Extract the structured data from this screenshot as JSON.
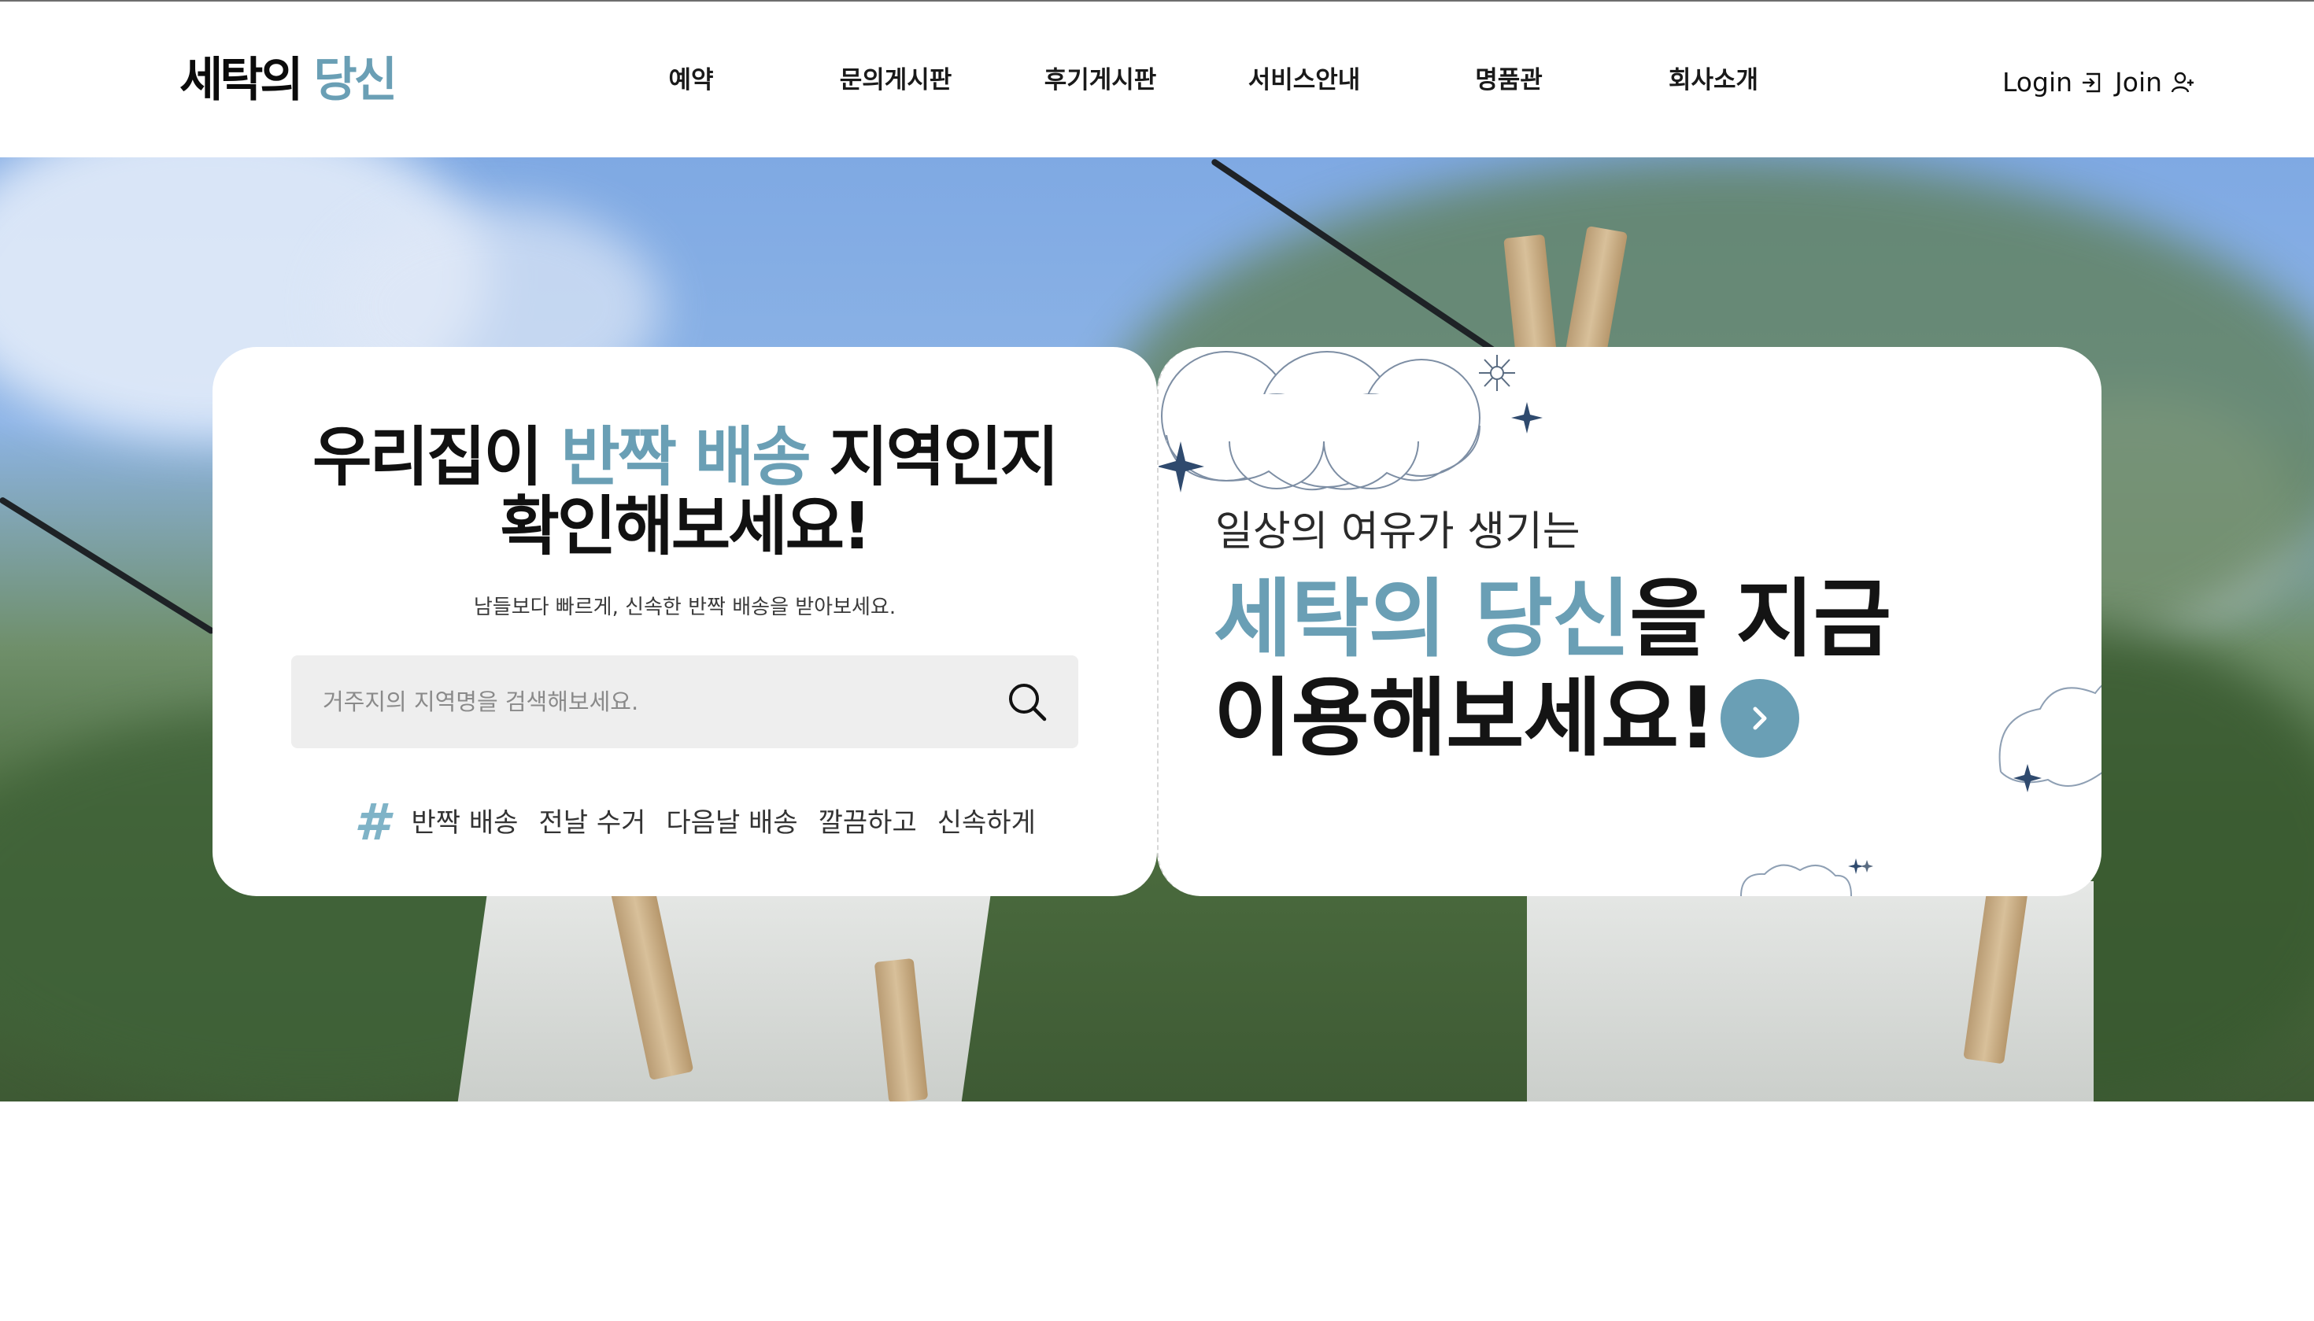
{
  "header": {
    "logo": {
      "part1": "세탁의 ",
      "part2": "당신"
    },
    "nav": [
      {
        "label": "예약"
      },
      {
        "label": "문의게시판"
      },
      {
        "label": "후기게시판"
      },
      {
        "label": "서비스안내"
      },
      {
        "label": "명품관"
      },
      {
        "label": "회사소개"
      }
    ],
    "auth": {
      "login": "Login",
      "join": "Join"
    }
  },
  "search_card": {
    "headline_line1_pre": "우리집이 ",
    "headline_line1_accent": "반짝 배송",
    "headline_line1_post": " 지역인지",
    "headline_line2": "확인해보세요!",
    "subtext": "남들보다 빠르게, 신속한 반짝 배송을 받아보세요.",
    "search_placeholder": "거주지의 지역명을 검색해보세요.",
    "hash_symbol": "#",
    "tags": [
      "반짝 배송",
      "전날 수거",
      "다음날 배송",
      "깔끔하고",
      "신속하게"
    ]
  },
  "promo_card": {
    "small_text": "일상의 여유가 생기는",
    "big_accent": "세탁의 당신",
    "big_rest": "을 지금",
    "big_line2": "이용해보세요!"
  },
  "colors": {
    "accent": "#6a9fb5",
    "hash": "#7fb3c7",
    "deco_star": "#2f4a6e"
  },
  "icons": [
    "login-icon",
    "join-user-icon",
    "search-icon",
    "chevron-right-icon",
    "cloud-icon",
    "sparkle-icon"
  ]
}
